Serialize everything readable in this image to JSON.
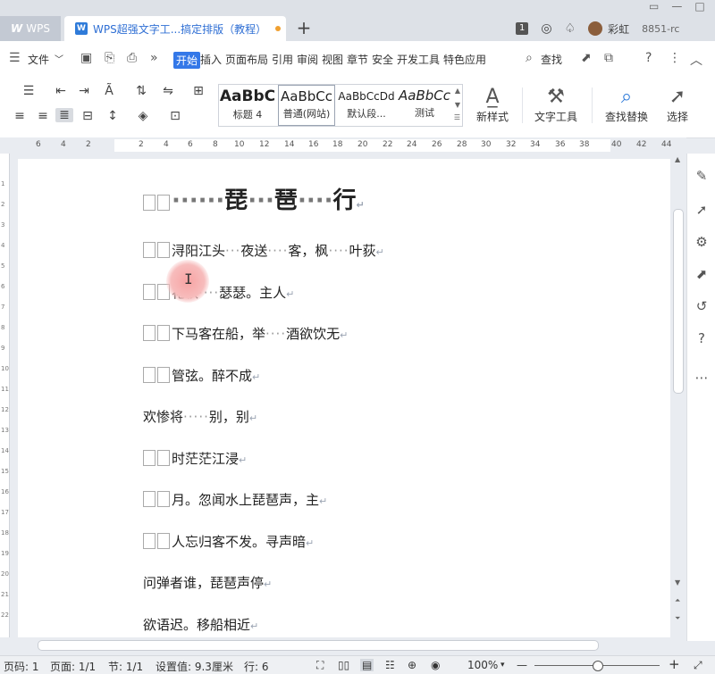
{
  "tabs": {
    "wps_label": "WPS",
    "doc_title": "WPS超强文字工...搞定排版（教程）",
    "new_tab": "+",
    "window_controls": [
      "▭",
      "—",
      "□",
      "✕"
    ],
    "badge_num": "1",
    "user_name": "彩虹",
    "version": "8851-rc"
  },
  "menubar": {
    "hamburger": "☰",
    "file": "文件",
    "file_caret": "﹀",
    "more": "»",
    "items": [
      "开始",
      "插入",
      "页面布局",
      "引用",
      "审阅",
      "视图",
      "章节",
      "安全",
      "开发工具",
      "特色应用"
    ],
    "search": "查找",
    "help": "?",
    "menu_more": "⋮",
    "collapse": "︿"
  },
  "ribbon": {
    "styles": [
      {
        "sample": "AaBbC",
        "label": "标题 4"
      },
      {
        "sample": "AaBbCc",
        "label": "普通(网站)"
      },
      {
        "sample": "AaBbCcDd",
        "label": "默认段..."
      },
      {
        "sample": "AaBbCc",
        "label": "测试"
      }
    ],
    "new_style": "新样式",
    "text_tools": "文字工具",
    "find_replace": "查找替换",
    "select": "选择"
  },
  "ruler": {
    "h_ticks": [
      "6",
      "4",
      "2",
      "2",
      "4",
      "6",
      "8",
      "10",
      "12",
      "14",
      "16",
      "18",
      "20",
      "22",
      "24",
      "26",
      "28",
      "30",
      "32",
      "34",
      "36",
      "38",
      "40",
      "42",
      "44"
    ],
    "v_ticks": [
      "1",
      "2",
      "3",
      "4",
      "5",
      "6",
      "7",
      "8",
      "9",
      "10",
      "11",
      "12",
      "13",
      "14",
      "15",
      "16",
      "17",
      "18",
      "19",
      "20",
      "21",
      "22"
    ]
  },
  "document": {
    "title_chars": [
      "琵",
      "琶",
      "行"
    ],
    "lines": [
      {
        "boxes": 2,
        "text": "浔阳江头",
        "d1": "···",
        "t2": "夜送",
        "d2": "····",
        "t3": "客，枫",
        "d3": "····",
        "t4": "叶荻"
      },
      {
        "boxes": 2,
        "text": "花秋",
        "d1": "····",
        "t2": "瑟瑟。主人",
        "d2": "",
        "t3": "",
        "d3": "",
        "t4": ""
      },
      {
        "boxes": 2,
        "text": "下马客在船，举",
        "d1": "····",
        "t2": "酒欲饮无",
        "d2": "",
        "t3": "",
        "d3": "",
        "t4": ""
      },
      {
        "boxes": 2,
        "text": "管弦。醉不成",
        "d1": "",
        "t2": "",
        "d2": "",
        "t3": "",
        "d3": "",
        "t4": ""
      },
      {
        "boxes": 0,
        "text": "欢惨将",
        "d1": "·····",
        "t2": "别，别",
        "d2": "",
        "t3": "",
        "d3": "",
        "t4": ""
      },
      {
        "boxes": 2,
        "text": "时茫茫江浸",
        "d1": "",
        "t2": "",
        "d2": "",
        "t3": "",
        "d3": "",
        "t4": ""
      },
      {
        "boxes": 2,
        "text": "月。忽闻水上琵琶声，主",
        "d1": "",
        "t2": "",
        "d2": "",
        "t3": "",
        "d3": "",
        "t4": ""
      },
      {
        "boxes": 2,
        "text": "人忘归客不发。寻声暗",
        "d1": "",
        "t2": "",
        "d2": "",
        "t3": "",
        "d3": "",
        "t4": ""
      },
      {
        "boxes": 0,
        "text": "问弹者谁，琵琶声停",
        "d1": "",
        "t2": "",
        "d2": "",
        "t3": "",
        "d3": "",
        "t4": ""
      },
      {
        "boxes": 0,
        "text": "欲语迟。移船相近",
        "d1": "",
        "t2": "",
        "d2": "",
        "t3": "",
        "d3": "",
        "t4": ""
      }
    ],
    "para_mark": "↵"
  },
  "status": {
    "page_code": "页码: 1",
    "page": "页面: 1/1",
    "section": "节: 1/1",
    "setting": "设置值: 9.3厘米",
    "row": "行: 6",
    "zoom": "100%",
    "zoom_caret": "▾",
    "minus": "—",
    "plus": "+",
    "expand": "⤢"
  },
  "colors": {
    "accent": "#3478e8",
    "tab_text": "#2f6fd4",
    "cursor_glow": "#f7a3a3"
  }
}
